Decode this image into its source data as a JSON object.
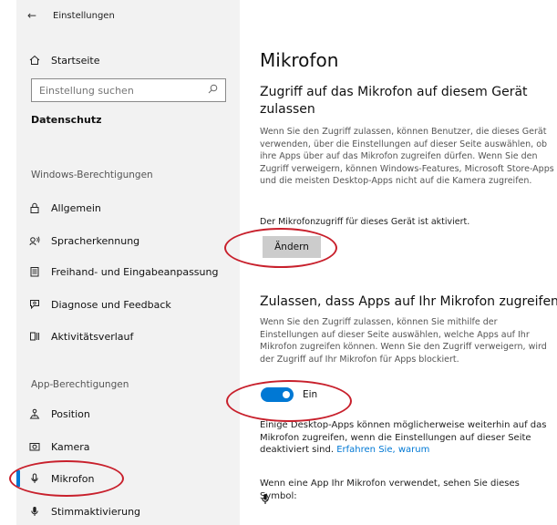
{
  "window": {
    "title": "Einstellungen"
  },
  "sidebar": {
    "home_label": "Startseite",
    "search_placeholder": "Einstellung suchen",
    "group_header": "Datenschutz",
    "section_windows": "Windows-Berechtigungen",
    "windows_items": [
      {
        "label": "Allgemein",
        "icon": "lock-icon"
      },
      {
        "label": "Spracherkennung",
        "icon": "speech-icon"
      },
      {
        "label": "Freihand- und Eingabeanpassung",
        "icon": "notepad-icon"
      },
      {
        "label": "Diagnose und Feedback",
        "icon": "feedback-icon"
      },
      {
        "label": "Aktivitätsverlauf",
        "icon": "timeline-icon"
      }
    ],
    "section_apps": "App-Berechtigungen",
    "app_items": [
      {
        "label": "Position",
        "icon": "location-icon"
      },
      {
        "label": "Kamera",
        "icon": "camera-icon"
      },
      {
        "label": "Mikrofon",
        "icon": "microphone-icon",
        "active": true
      },
      {
        "label": "Stimmaktivierung",
        "icon": "voice-activation-icon"
      }
    ]
  },
  "main": {
    "title": "Mikrofon",
    "device_heading": "Zugriff auf das Mikrofon auf diesem Gerät zulassen",
    "device_text": "Wenn Sie den Zugriff zulassen, können Benutzer, die dieses Gerät verwenden, über die Einstellungen auf dieser Seite auswählen, ob ihre Apps über auf das Mikrofon zugreifen dürfen. Wenn Sie den Zugriff verweigern, können Windows-Features, Microsoft Store-Apps und die meisten Desktop-Apps nicht auf die Kamera zugreifen.",
    "device_status": "Der Mikrofonzugriff für dieses Gerät ist aktiviert.",
    "change_button": "Ändern",
    "apps_heading": "Zulassen, dass Apps auf Ihr Mikrofon zugreifen",
    "apps_text": "Wenn Sie den Zugriff zulassen, können Sie mithilfe der Einstellungen auf dieser Seite auswählen, welche Apps auf Ihr Mikrofon zugreifen können. Wenn Sie den Zugriff verweigern, wird der Zugriff auf Ihr Mikrofon für Apps blockiert.",
    "toggle_label": "Ein",
    "toggle_on": true,
    "desktop_text": "Einige Desktop-Apps können möglicherweise weiterhin auf das Mikrofon zugreifen, wenn die Einstellungen auf dieser Seite deaktiviert sind.",
    "learn_more_link": "Erfahren Sie, warum",
    "symbol_text": "Wenn eine App Ihr Mikrofon verwendet, sehen Sie dieses Symbol:"
  },
  "colors": {
    "accent": "#0078d4",
    "annotation": "#c8202c",
    "sidebar_bg": "#f2f2f2"
  }
}
